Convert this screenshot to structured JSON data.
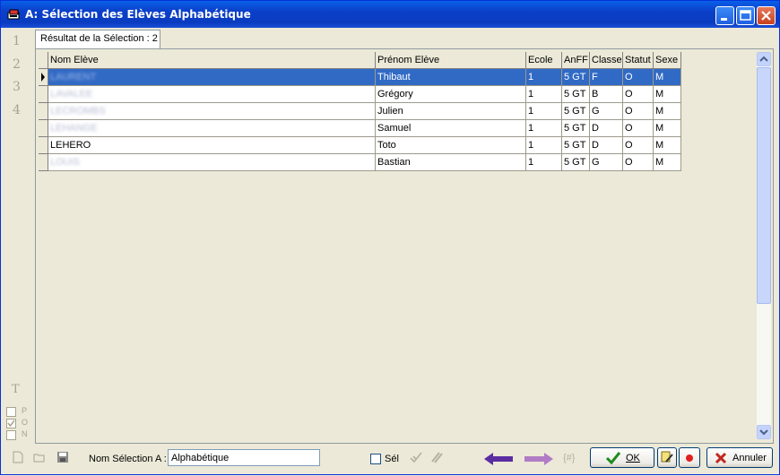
{
  "window": {
    "title": "A: Sélection des Elèves Alphabétique"
  },
  "left_numbers": [
    "1",
    "2",
    "3",
    "4"
  ],
  "tab": {
    "label": "Résultat de la Sélection : 2"
  },
  "columns": [
    "Nom Elève",
    "Prénom Elève",
    "Ecole",
    "AnFF",
    "Classe",
    "Statut",
    "Sexe"
  ],
  "rows": [
    {
      "nom": "LAURENT",
      "prenom": "Thibaut",
      "ecole": "1",
      "anff": "5 GT",
      "classe": "F",
      "statut": "O",
      "sexe": "M",
      "selected": true,
      "blurred": true
    },
    {
      "nom": "LAVALEE",
      "prenom": "Grégory",
      "ecole": "1",
      "anff": "5 GT",
      "classe": "B",
      "statut": "O",
      "sexe": "M",
      "blurred": true
    },
    {
      "nom": "LECROMBS",
      "prenom": "Julien",
      "ecole": "1",
      "anff": "5 GT",
      "classe": "G",
      "statut": "O",
      "sexe": "M",
      "blurred": true
    },
    {
      "nom": "LEHANGE",
      "prenom": "Samuel",
      "ecole": "1",
      "anff": "5 GT",
      "classe": "D",
      "statut": "O",
      "sexe": "M",
      "blurred": true
    },
    {
      "nom": "LEHERO",
      "prenom": "Toto",
      "ecole": "1",
      "anff": "5 GT",
      "classe": "D",
      "statut": "O",
      "sexe": "M",
      "blurred": false
    },
    {
      "nom": "LOUIS",
      "prenom": "Bastian",
      "ecole": "1",
      "anff": "5 GT",
      "classe": "G",
      "statut": "O",
      "sexe": "M",
      "blurred": true
    }
  ],
  "side_labels": {
    "t": "T",
    "p": "P",
    "o": "O",
    "n": "N"
  },
  "bottom": {
    "nom_selection_label": "Nom Sélection A :",
    "nom_selection_value": "Alphabétique",
    "sel_label": "Sél",
    "hash_label": "{#}",
    "ok_label": "OK",
    "annuler_label": "Annuler"
  },
  "colors": {
    "selection": "#316AC5",
    "arrow_active": "#5A2DA0",
    "arrow_inactive": "#B07CC6",
    "ok_check": "#1E8C1E",
    "cancel_x": "#C0281E"
  }
}
